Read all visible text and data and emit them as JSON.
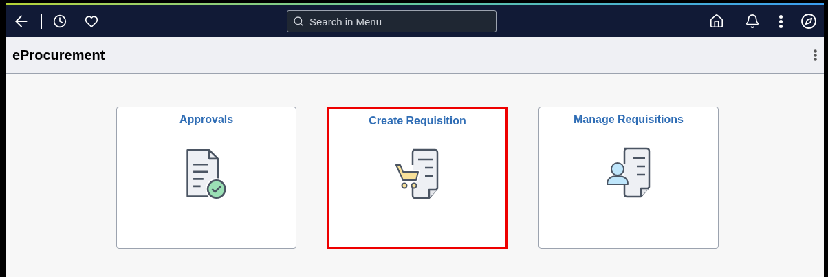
{
  "search": {
    "placeholder": "Search in Menu"
  },
  "page_title": "eProcurement",
  "tiles": [
    {
      "title": "Approvals",
      "kind": "approval",
      "highlighted": false
    },
    {
      "title": "Create Requisition",
      "kind": "cart",
      "highlighted": true
    },
    {
      "title": "Manage Requisitions",
      "kind": "person",
      "highlighted": false
    }
  ]
}
